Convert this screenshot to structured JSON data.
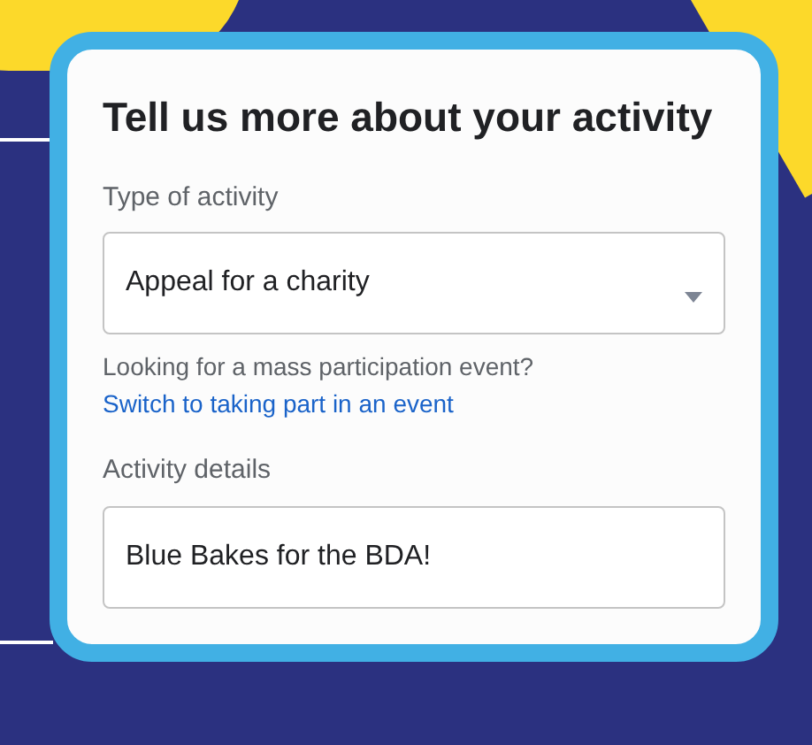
{
  "card": {
    "title": "Tell us more about your activity",
    "type_field": {
      "label": "Type of activity",
      "value": "Appeal for a charity"
    },
    "hint": "Looking for a mass participation event?",
    "link": "Switch to taking part in an event",
    "details_field": {
      "label": "Activity details",
      "value": "Blue Bakes for the BDA!"
    }
  }
}
